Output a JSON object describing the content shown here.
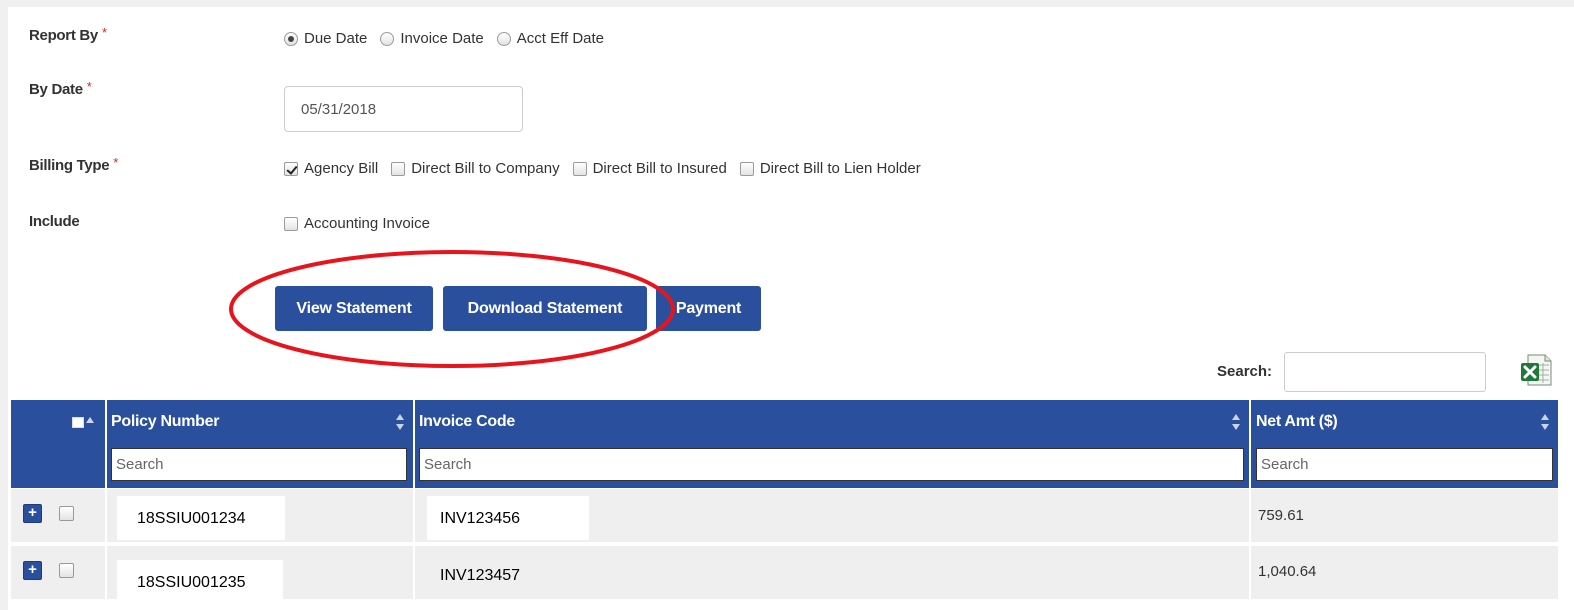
{
  "form": {
    "report_by": {
      "label": "Report By",
      "required": "*",
      "options": [
        {
          "label": "Due Date",
          "checked": true
        },
        {
          "label": "Invoice Date",
          "checked": false
        },
        {
          "label": "Acct Eff Date",
          "checked": false
        }
      ]
    },
    "by_date": {
      "label": "By Date",
      "required": "*",
      "value": "05/31/2018"
    },
    "billing_type": {
      "label": "Billing Type",
      "required": "*",
      "options": [
        {
          "label": "Agency Bill",
          "checked": true
        },
        {
          "label": "Direct Bill to Company",
          "checked": false
        },
        {
          "label": "Direct Bill to Insured",
          "checked": false
        },
        {
          "label": "Direct Bill to Lien Holder",
          "checked": false
        }
      ]
    },
    "include": {
      "label": "Include",
      "options": [
        {
          "label": "Accounting Invoice",
          "checked": false
        }
      ]
    }
  },
  "actions": {
    "view_statement": "View Statement",
    "download_statement": "Download Statement",
    "payment": "Payment"
  },
  "table_search": {
    "label": "Search:",
    "value": ""
  },
  "table": {
    "columns": [
      {
        "key": "policy_number",
        "label": "Policy Number",
        "search_placeholder": "Search"
      },
      {
        "key": "invoice_code",
        "label": "Invoice Code",
        "search_placeholder": "Search"
      },
      {
        "key": "net_amt",
        "label": "Net Amt ($)",
        "search_placeholder": "Search"
      }
    ],
    "rows": [
      {
        "expand": "+",
        "policy_number": "18SSIU001234",
        "invoice_code": "INV123456",
        "net_amt": "759.61"
      },
      {
        "expand": "+",
        "policy_number": "18SSIU001235",
        "invoice_code": "INV123457",
        "net_amt": "1,040.64"
      }
    ]
  },
  "colors": {
    "primary": "#2a4f9d",
    "required": "#e02020",
    "highlight": "#e8141c",
    "row_bg": "#efefef"
  },
  "icons": {
    "excel_export": "excel-icon",
    "sort": "sort-icon",
    "expand": "plus-icon"
  }
}
